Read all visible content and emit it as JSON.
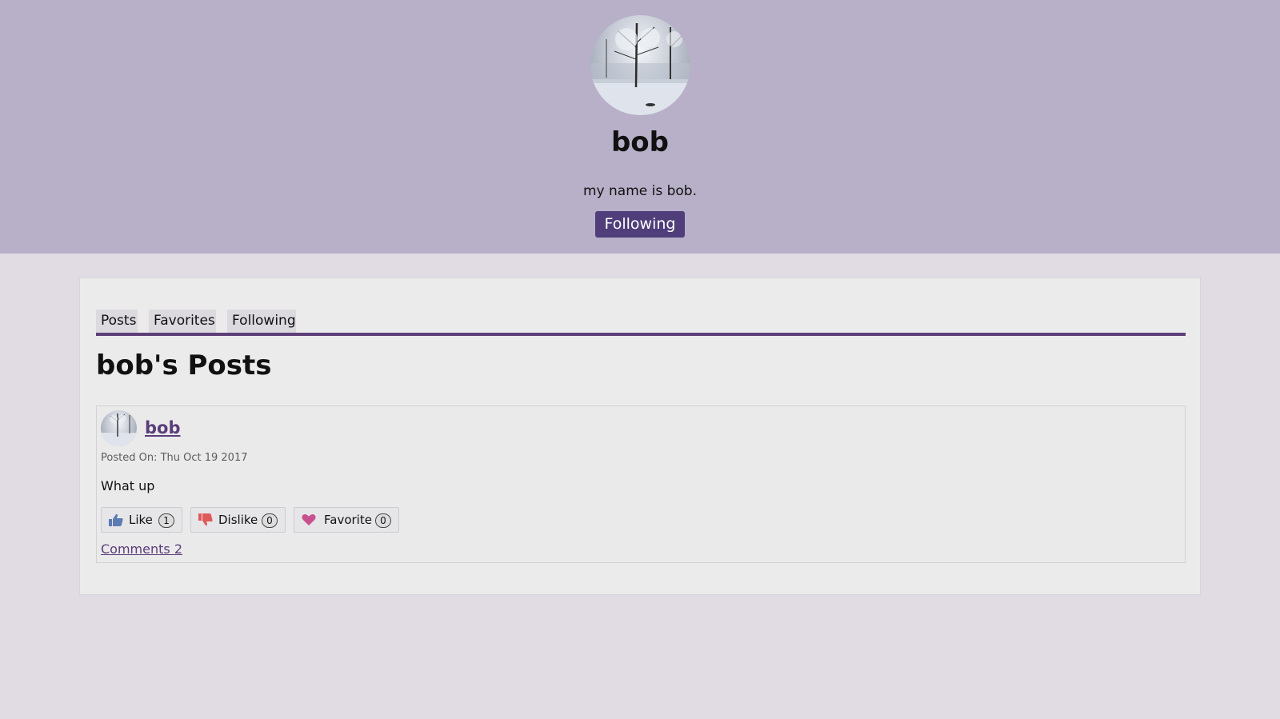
{
  "profile": {
    "name": "bob",
    "bio": "my name is bob.",
    "follow_button": "Following"
  },
  "tabs": [
    {
      "label": "Posts"
    },
    {
      "label": "Favorites"
    },
    {
      "label": "Following"
    }
  ],
  "section_title": "bob's Posts",
  "post": {
    "author": "bob",
    "date": "Posted On: Thu Oct 19 2017",
    "body": "What up",
    "reactions": {
      "like": {
        "label": "Like",
        "count": "1",
        "icon": "thumbs-up-icon",
        "color": "#5b7bb5"
      },
      "dislike": {
        "label": "Dislike",
        "count": "0",
        "icon": "thumbs-down-icon",
        "color": "#e05a5a"
      },
      "favorite": {
        "label": "Favorite",
        "count": "0",
        "icon": "heart-icon",
        "color": "#c8508f"
      }
    },
    "comments_link": "Comments 2"
  },
  "colors": {
    "header_bg": "#b7b0c8",
    "page_bg": "#e1dbe3",
    "accent": "#4f3e7a",
    "link": "#5a3d7a"
  }
}
